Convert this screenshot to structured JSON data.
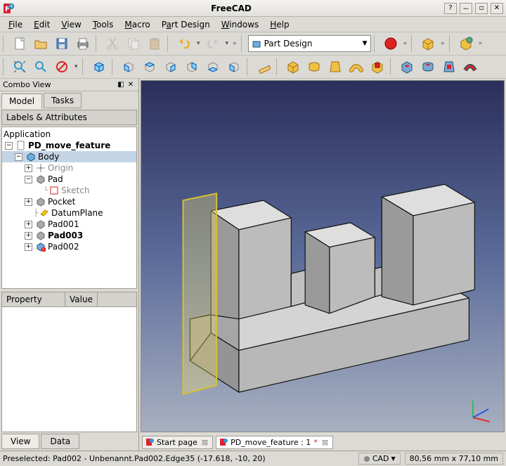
{
  "title": "FreeCAD",
  "menu": {
    "file": "File",
    "edit": "Edit",
    "view": "View",
    "tools": "Tools",
    "macro": "Macro",
    "partdesign": "Part Design",
    "windows": "Windows",
    "help": "Help"
  },
  "workbench": "Part Design",
  "combo": {
    "title": "Combo View",
    "tabs": {
      "model": "Model",
      "tasks": "Tasks"
    },
    "panel_header": "Labels & Attributes",
    "tree": {
      "root": "Application",
      "doc": "PD_move_feature",
      "body": "Body",
      "origin": "Origin",
      "pad": "Pad",
      "sketch": "Sketch",
      "pocket": "Pocket",
      "datum": "DatumPlane",
      "pad001": "Pad001",
      "pad003": "Pad003",
      "pad002": "Pad002"
    },
    "prop": {
      "col1": "Property",
      "col2": "Value"
    },
    "bottom_tabs": {
      "view": "View",
      "data": "Data"
    }
  },
  "doctabs": {
    "start": "Start page",
    "doc": "PD_move_feature : 1",
    "dirty": "*"
  },
  "status": {
    "msg": "Preselected: Pad002 - Unbenannt.Pad002.Edge35 (-17.618, -10, 20)",
    "mode": "CAD",
    "dims": "80,56 mm x 77,10 mm"
  }
}
